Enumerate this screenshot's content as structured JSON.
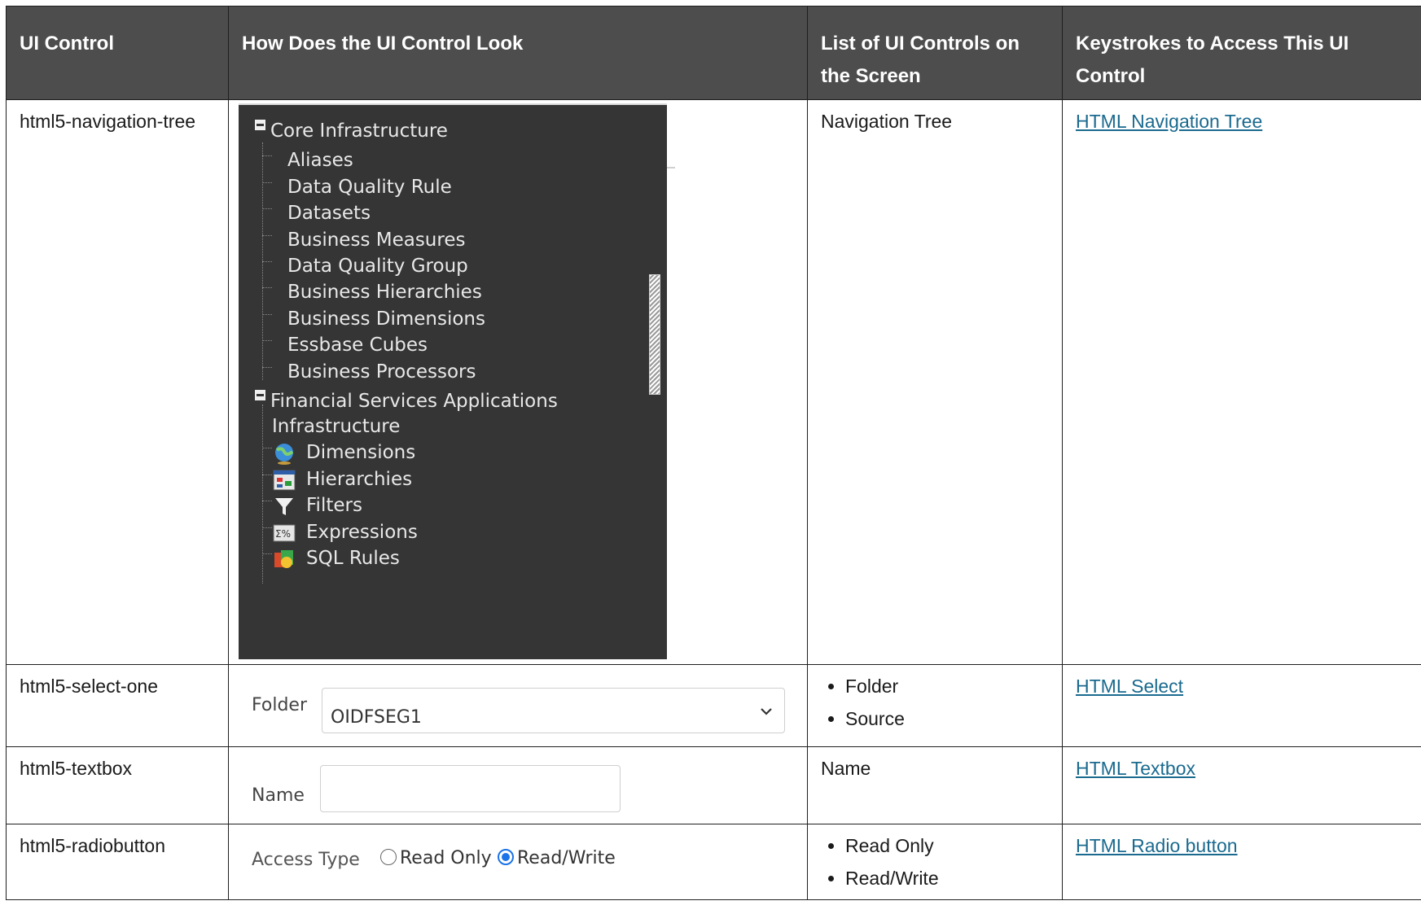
{
  "table": {
    "headers": [
      "UI Control",
      "How Does the UI Control Look",
      "List of UI Controls on the Screen",
      "Keystrokes to Access This UI Control"
    ],
    "rows": [
      {
        "control": "html5-navigation-tree",
        "list": [
          "Navigation Tree"
        ],
        "link": "HTML Navigation Tree"
      },
      {
        "control": "html5-select-one",
        "list": [
          "Folder",
          "Source"
        ],
        "link": "HTML Select"
      },
      {
        "control": "html5-textbox",
        "list": [
          "Name"
        ],
        "link": "HTML Textbox"
      },
      {
        "control": "html5-radiobutton",
        "list": [
          "Read Only",
          "Read/Write"
        ],
        "link": "HTML Radio button"
      }
    ]
  },
  "tree": {
    "root1": "Core Infrastructure",
    "root1_children": [
      "Aliases",
      "Data Quality Rule",
      "Datasets",
      "Business Measures",
      "Data Quality Group",
      "Business Hierarchies",
      "Business Dimensions",
      "Essbase Cubes",
      "Business Processors"
    ],
    "root2_line1": "Financial Services Applications",
    "root2_line2": "Infrastructure",
    "root2_children": [
      {
        "label": "Dimensions",
        "icon": "globe-icon"
      },
      {
        "label": "Hierarchies",
        "icon": "hierarchy-icon"
      },
      {
        "label": "Filters",
        "icon": "filter-icon"
      },
      {
        "label": "Expressions",
        "icon": "expression-icon"
      },
      {
        "label": "SQL Rules",
        "icon": "sql-rules-icon"
      }
    ]
  },
  "select_sample": {
    "label": "Folder",
    "value": "OIDFSEG1"
  },
  "textbox_sample": {
    "label": "Name",
    "value": ""
  },
  "radio_sample": {
    "label": "Access Type",
    "option1": "Read Only",
    "option2": "Read/Write",
    "selected": "Read/Write"
  },
  "colors": {
    "header_bg": "#4d4d4d",
    "tree_bg": "#353535",
    "link": "#1a6a8f",
    "radio_accent": "#1a73e8"
  }
}
